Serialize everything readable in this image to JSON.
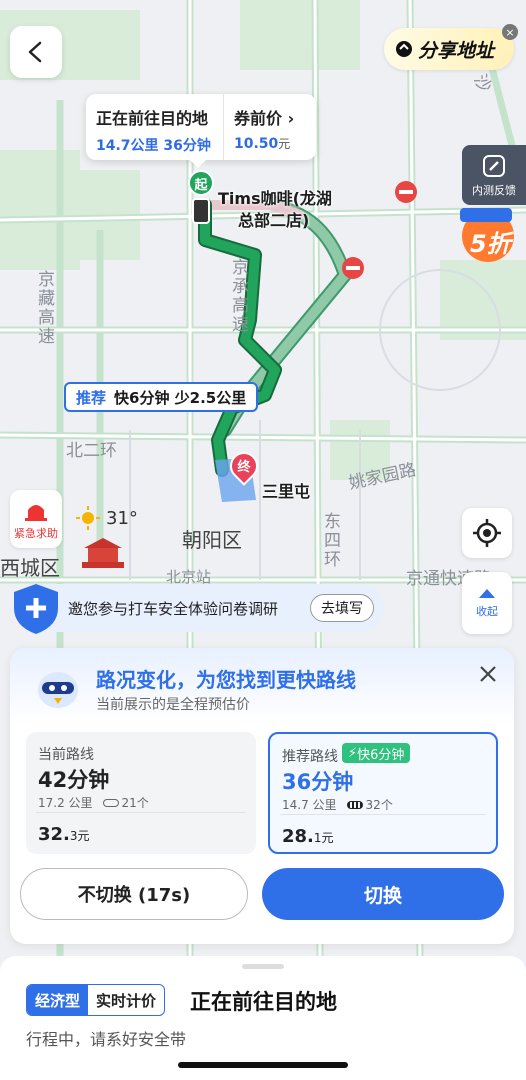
{
  "map": {
    "district_labels": [
      "西城区",
      "朝阳区"
    ],
    "road_labels": {
      "jingzang": "京藏高速",
      "jingcheng": "京承高速",
      "beierhuan": "北二环",
      "yaojiayuan": "姚家园路",
      "dongsihuan": "东四环",
      "jingtong": "京通快速路",
      "beijingzhan": "北京站",
      "shakeleft": "沙"
    },
    "start_marker": "起",
    "end_marker": "终",
    "start_poi": "Tims咖啡(龙湖总部二店)",
    "start_poi_line1": "Tims咖啡(龙湖",
    "start_poi_line2": "总部二店)",
    "end_poi": "三里屯",
    "recommend_tag": {
      "label": "推荐",
      "detail": "快6分钟 少2.5公里"
    },
    "weather": {
      "temp": "31°"
    },
    "colors": {
      "route_green": "#21a45b",
      "route_alt": "#8fc9a8",
      "accent": "#2f6fe8"
    }
  },
  "top": {
    "back_icon": "chevron-left-icon",
    "share_label": "分享地址",
    "trip_card": {
      "status": "正在前往目的地",
      "distance_time": "14.7公里 36分钟",
      "price_label": "券前价",
      "price_value": "10.50",
      "price_unit": "元"
    },
    "feedback_label": "内测反馈",
    "promo_badge": "5折"
  },
  "side": {
    "sos_label": "紧急求助",
    "collapse_label": "收起"
  },
  "survey": {
    "text": "邀您参与打车安全体验问卷调研",
    "button": "去填写"
  },
  "panel": {
    "title": "路况变化，为您找到更快路线",
    "subtitle": "当前展示的是全程预估价",
    "current": {
      "label": "当前路线",
      "time": "42分钟",
      "distance": "17.2 公里",
      "lights": "21个",
      "price": "32.",
      "price_dec": "3",
      "price_unit": "元"
    },
    "recommended": {
      "label": "推荐路线",
      "fast_badge": "快6分钟",
      "time": "36分钟",
      "distance": "14.7 公里",
      "lights": "32个",
      "price": "28.",
      "price_dec": "1",
      "price_unit": "元"
    },
    "btn_keep": "不切换 (17s)",
    "btn_switch": "切换"
  },
  "bottom": {
    "tag_economy": "经济型",
    "tag_realtime": "实时计价",
    "status": "正在前往目的地",
    "subtitle": "行程中，请系好安全带"
  }
}
